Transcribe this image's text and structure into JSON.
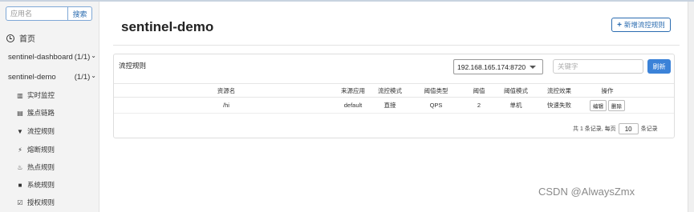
{
  "sidebar": {
    "search_placeholder": "应用名",
    "search_button": "搜索",
    "home_label": "首页",
    "apps": [
      {
        "name": "sentinel-dashboard",
        "count": "(1/1)"
      },
      {
        "name": "sentinel-demo",
        "count": "(1/1)"
      }
    ],
    "menu": [
      {
        "label": "实时监控",
        "icon": "bar-chart-icon"
      },
      {
        "label": "簇点链路",
        "icon": "list-icon"
      },
      {
        "label": "流控规则",
        "icon": "filter-icon"
      },
      {
        "label": "熔断规则",
        "icon": "bolt-icon"
      },
      {
        "label": "热点规则",
        "icon": "fire-icon"
      },
      {
        "label": "系统规则",
        "icon": "lock-icon"
      },
      {
        "label": "授权规则",
        "icon": "check-square-icon"
      }
    ]
  },
  "main": {
    "title": "sentinel-demo",
    "add_button": "新增流控规则",
    "panel_title": "流控规则",
    "machine_select": "192.168.165.174:8720",
    "keyword_placeholder": "关键字",
    "refresh_button": "刷新",
    "table": {
      "headers": [
        "资源名",
        "来源应用",
        "流控模式",
        "阈值类型",
        "阈值",
        "阈值模式",
        "流控效果",
        "操作"
      ],
      "rows": [
        {
          "resource": "/hi",
          "origin": "default",
          "mode": "直接",
          "grade": "QPS",
          "count": "2",
          "cluster_mode": "单机",
          "effect": "快速失败",
          "edit": "编辑",
          "delete": "删除"
        }
      ]
    },
    "pager": {
      "prefix": "共 1 条记录, 每页",
      "page_size": "10",
      "suffix": "条记录"
    }
  },
  "watermark": "CSDN @AlwaysZmx",
  "colors": {
    "accent": "#3b82d8",
    "sidebar_bg": "#f3f3f3"
  }
}
